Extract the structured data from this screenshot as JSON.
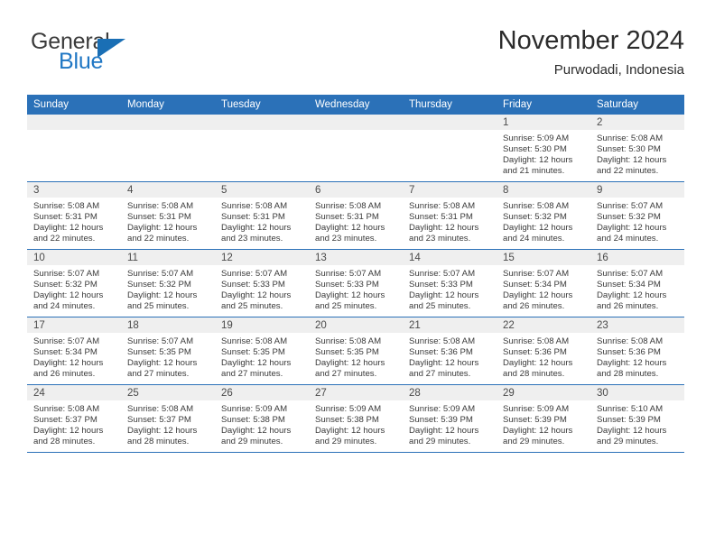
{
  "brand": {
    "name_top": "General",
    "name_bottom": "Blue",
    "accent_color": "#2077c4",
    "triangle_color": "#1a6fb5"
  },
  "header": {
    "title": "November 2024",
    "subtitle": "Purwodadi, Indonesia"
  },
  "theme": {
    "header_bar_color": "#2b71b8",
    "daynum_band_color": "#efefef",
    "row_separator_color": "#2b71b8",
    "text_color": "#3a3a3a"
  },
  "calendar": {
    "weekday_headers": [
      "Sunday",
      "Monday",
      "Tuesday",
      "Wednesday",
      "Thursday",
      "Friday",
      "Saturday"
    ],
    "weeks": [
      [
        {
          "day": "",
          "empty": true
        },
        {
          "day": "",
          "empty": true
        },
        {
          "day": "",
          "empty": true
        },
        {
          "day": "",
          "empty": true
        },
        {
          "day": "",
          "empty": true
        },
        {
          "day": "1",
          "sunrise": "Sunrise: 5:09 AM",
          "sunset": "Sunset: 5:30 PM",
          "daylight": "Daylight: 12 hours and 21 minutes."
        },
        {
          "day": "2",
          "sunrise": "Sunrise: 5:08 AM",
          "sunset": "Sunset: 5:30 PM",
          "daylight": "Daylight: 12 hours and 22 minutes."
        }
      ],
      [
        {
          "day": "3",
          "sunrise": "Sunrise: 5:08 AM",
          "sunset": "Sunset: 5:31 PM",
          "daylight": "Daylight: 12 hours and 22 minutes."
        },
        {
          "day": "4",
          "sunrise": "Sunrise: 5:08 AM",
          "sunset": "Sunset: 5:31 PM",
          "daylight": "Daylight: 12 hours and 22 minutes."
        },
        {
          "day": "5",
          "sunrise": "Sunrise: 5:08 AM",
          "sunset": "Sunset: 5:31 PM",
          "daylight": "Daylight: 12 hours and 23 minutes."
        },
        {
          "day": "6",
          "sunrise": "Sunrise: 5:08 AM",
          "sunset": "Sunset: 5:31 PM",
          "daylight": "Daylight: 12 hours and 23 minutes."
        },
        {
          "day": "7",
          "sunrise": "Sunrise: 5:08 AM",
          "sunset": "Sunset: 5:31 PM",
          "daylight": "Daylight: 12 hours and 23 minutes."
        },
        {
          "day": "8",
          "sunrise": "Sunrise: 5:08 AM",
          "sunset": "Sunset: 5:32 PM",
          "daylight": "Daylight: 12 hours and 24 minutes."
        },
        {
          "day": "9",
          "sunrise": "Sunrise: 5:07 AM",
          "sunset": "Sunset: 5:32 PM",
          "daylight": "Daylight: 12 hours and 24 minutes."
        }
      ],
      [
        {
          "day": "10",
          "sunrise": "Sunrise: 5:07 AM",
          "sunset": "Sunset: 5:32 PM",
          "daylight": "Daylight: 12 hours and 24 minutes."
        },
        {
          "day": "11",
          "sunrise": "Sunrise: 5:07 AM",
          "sunset": "Sunset: 5:32 PM",
          "daylight": "Daylight: 12 hours and 25 minutes."
        },
        {
          "day": "12",
          "sunrise": "Sunrise: 5:07 AM",
          "sunset": "Sunset: 5:33 PM",
          "daylight": "Daylight: 12 hours and 25 minutes."
        },
        {
          "day": "13",
          "sunrise": "Sunrise: 5:07 AM",
          "sunset": "Sunset: 5:33 PM",
          "daylight": "Daylight: 12 hours and 25 minutes."
        },
        {
          "day": "14",
          "sunrise": "Sunrise: 5:07 AM",
          "sunset": "Sunset: 5:33 PM",
          "daylight": "Daylight: 12 hours and 25 minutes."
        },
        {
          "day": "15",
          "sunrise": "Sunrise: 5:07 AM",
          "sunset": "Sunset: 5:34 PM",
          "daylight": "Daylight: 12 hours and 26 minutes."
        },
        {
          "day": "16",
          "sunrise": "Sunrise: 5:07 AM",
          "sunset": "Sunset: 5:34 PM",
          "daylight": "Daylight: 12 hours and 26 minutes."
        }
      ],
      [
        {
          "day": "17",
          "sunrise": "Sunrise: 5:07 AM",
          "sunset": "Sunset: 5:34 PM",
          "daylight": "Daylight: 12 hours and 26 minutes."
        },
        {
          "day": "18",
          "sunrise": "Sunrise: 5:07 AM",
          "sunset": "Sunset: 5:35 PM",
          "daylight": "Daylight: 12 hours and 27 minutes."
        },
        {
          "day": "19",
          "sunrise": "Sunrise: 5:08 AM",
          "sunset": "Sunset: 5:35 PM",
          "daylight": "Daylight: 12 hours and 27 minutes."
        },
        {
          "day": "20",
          "sunrise": "Sunrise: 5:08 AM",
          "sunset": "Sunset: 5:35 PM",
          "daylight": "Daylight: 12 hours and 27 minutes."
        },
        {
          "day": "21",
          "sunrise": "Sunrise: 5:08 AM",
          "sunset": "Sunset: 5:36 PM",
          "daylight": "Daylight: 12 hours and 27 minutes."
        },
        {
          "day": "22",
          "sunrise": "Sunrise: 5:08 AM",
          "sunset": "Sunset: 5:36 PM",
          "daylight": "Daylight: 12 hours and 28 minutes."
        },
        {
          "day": "23",
          "sunrise": "Sunrise: 5:08 AM",
          "sunset": "Sunset: 5:36 PM",
          "daylight": "Daylight: 12 hours and 28 minutes."
        }
      ],
      [
        {
          "day": "24",
          "sunrise": "Sunrise: 5:08 AM",
          "sunset": "Sunset: 5:37 PM",
          "daylight": "Daylight: 12 hours and 28 minutes."
        },
        {
          "day": "25",
          "sunrise": "Sunrise: 5:08 AM",
          "sunset": "Sunset: 5:37 PM",
          "daylight": "Daylight: 12 hours and 28 minutes."
        },
        {
          "day": "26",
          "sunrise": "Sunrise: 5:09 AM",
          "sunset": "Sunset: 5:38 PM",
          "daylight": "Daylight: 12 hours and 29 minutes."
        },
        {
          "day": "27",
          "sunrise": "Sunrise: 5:09 AM",
          "sunset": "Sunset: 5:38 PM",
          "daylight": "Daylight: 12 hours and 29 minutes."
        },
        {
          "day": "28",
          "sunrise": "Sunrise: 5:09 AM",
          "sunset": "Sunset: 5:39 PM",
          "daylight": "Daylight: 12 hours and 29 minutes."
        },
        {
          "day": "29",
          "sunrise": "Sunrise: 5:09 AM",
          "sunset": "Sunset: 5:39 PM",
          "daylight": "Daylight: 12 hours and 29 minutes."
        },
        {
          "day": "30",
          "sunrise": "Sunrise: 5:10 AM",
          "sunset": "Sunset: 5:39 PM",
          "daylight": "Daylight: 12 hours and 29 minutes."
        }
      ]
    ]
  }
}
